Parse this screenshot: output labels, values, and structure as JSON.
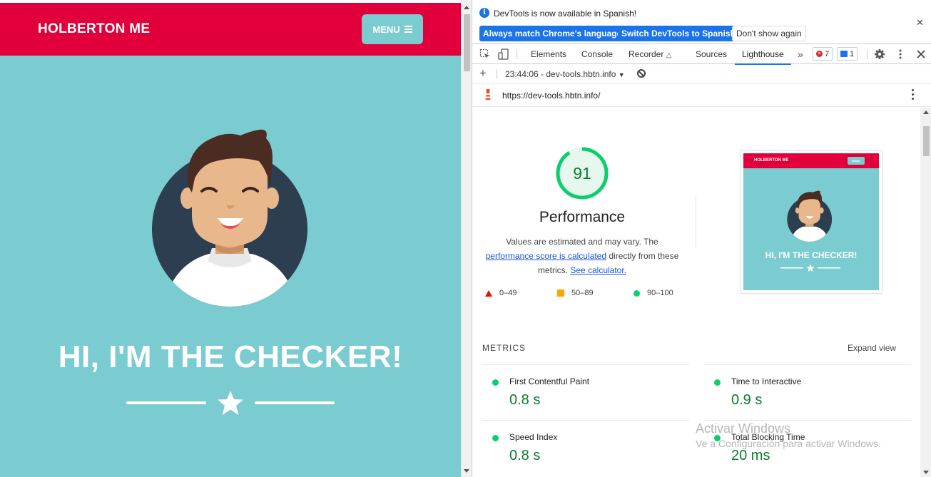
{
  "page": {
    "brand": "HOLBERTON ME",
    "menu_label": "MENU",
    "hero_title": "HI, I'M THE CHECKER!"
  },
  "devtools": {
    "infobar": {
      "message": "DevTools is now available in Spanish!",
      "btn_match": "Always match Chrome's language",
      "btn_switch": "Switch DevTools to Spanish",
      "btn_dismiss": "Don't show again"
    },
    "tabs": [
      "Elements",
      "Console",
      "Recorder",
      "Sources",
      "Lighthouse"
    ],
    "active_tab": "Lighthouse",
    "error_count": "7",
    "message_count": "1",
    "report_selector": "23:44:06 - dev-tools.hbtn.info",
    "url": "https://dev-tools.hbtn.info/"
  },
  "report": {
    "score": "91",
    "score_fraction": 0.91,
    "category": "Performance",
    "desc_1": "Values are estimated and may vary. The",
    "desc_link_1": "performance score is calculated",
    "desc_2": "directly from these",
    "desc_3": "metrics.",
    "desc_link_2": "See calculator.",
    "legend": {
      "fail": "0–49",
      "average": "50–89",
      "pass": "90–100"
    },
    "colors": {
      "pass": "#0cce6b",
      "average": "#ffa400",
      "fail": "#eb0f00"
    },
    "thumbnail": {
      "brand": "HOLBERTON ME",
      "menu": "MENU",
      "title": "HI, I'M THE CHECKER!"
    },
    "metrics_heading": "METRICS",
    "expand_label": "Expand view",
    "metrics": [
      {
        "label": "First Contentful Paint",
        "value": "0.8 s"
      },
      {
        "label": "Time to Interactive",
        "value": "0.9 s"
      },
      {
        "label": "Speed Index",
        "value": "0.8 s"
      },
      {
        "label": "Total Blocking Time",
        "value": "20 ms"
      }
    ]
  },
  "watermark": {
    "line1": "Activar Windows",
    "line2": "Ve a Configuración para activar Windows."
  }
}
